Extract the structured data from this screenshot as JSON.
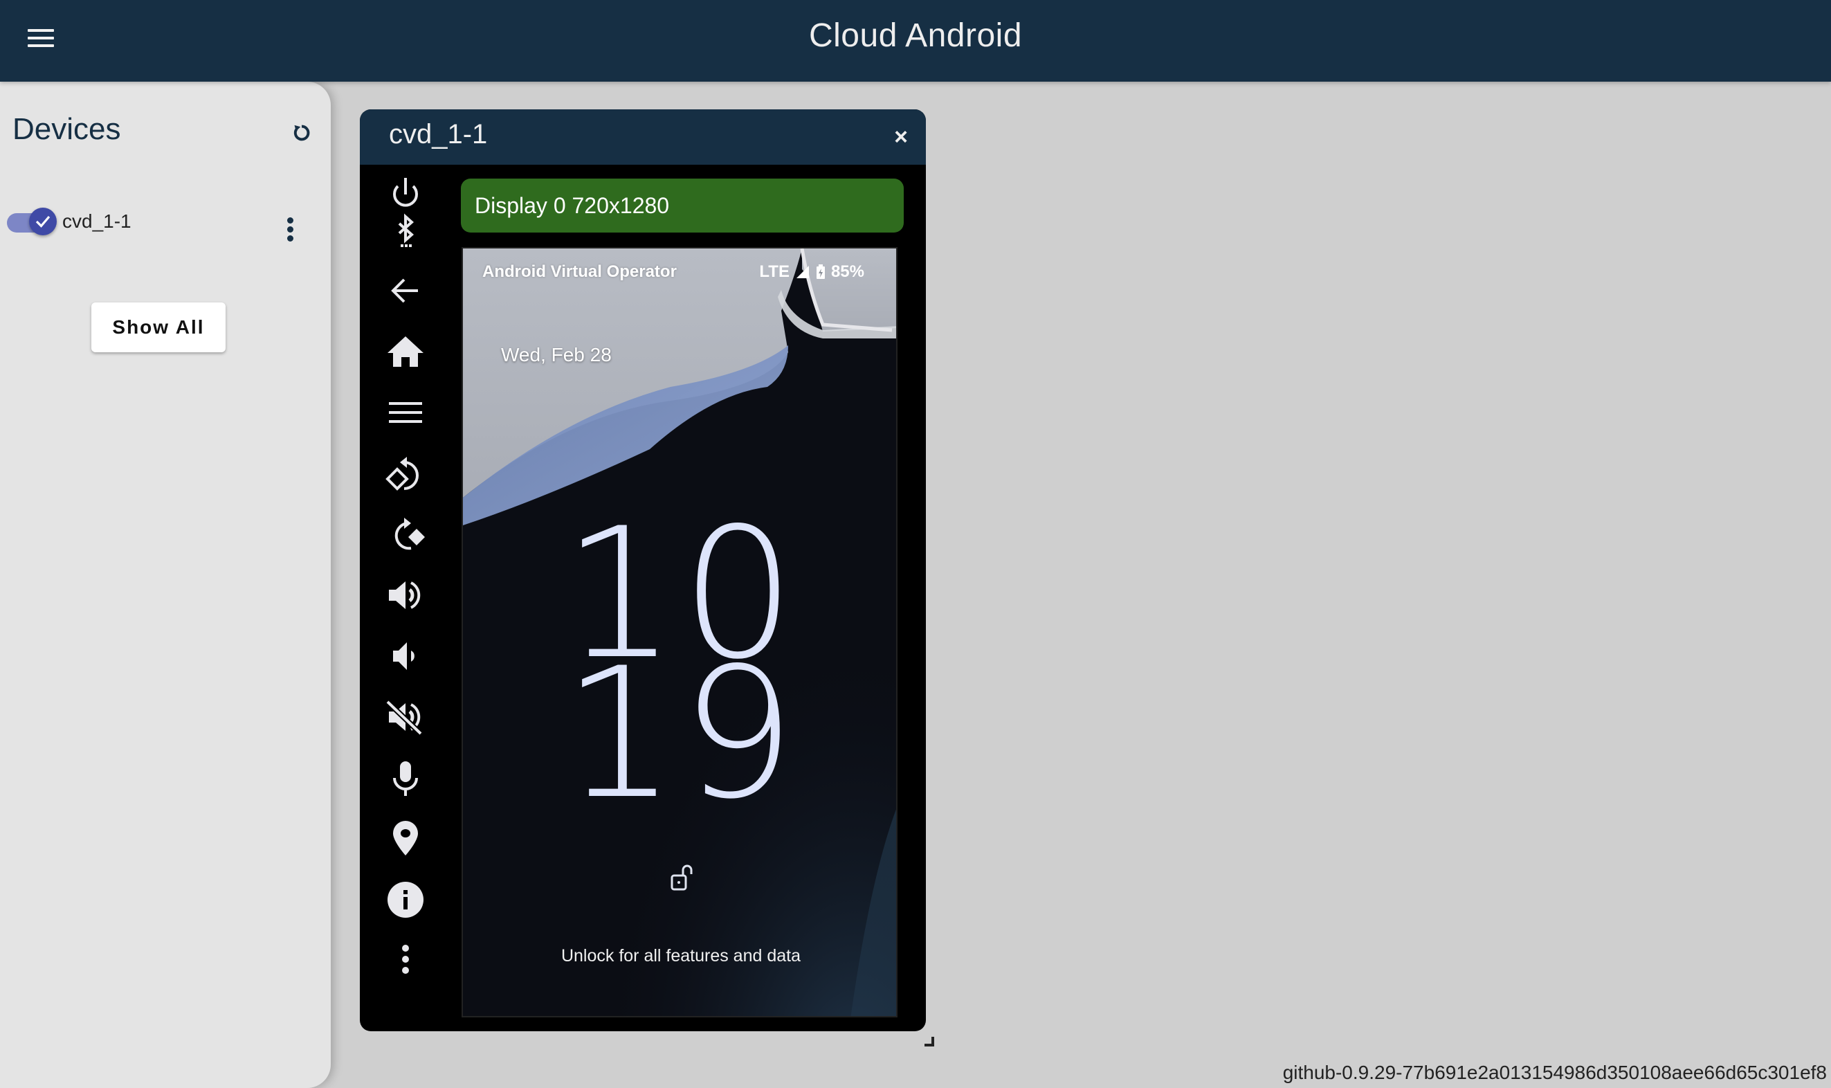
{
  "app": {
    "title": "Cloud Android",
    "menu_icon": "hamburger-menu-icon"
  },
  "sidebar": {
    "title": "Devices",
    "refresh_icon": "refresh-icon",
    "devices": [
      {
        "name": "cvd_1-1",
        "enabled": true,
        "more_icon": "more-vert-icon"
      }
    ],
    "show_all_label": "Show All"
  },
  "device_window": {
    "title": "cvd_1-1",
    "close_label": "×",
    "display_label": "Display 0 720x1280",
    "toolbar": [
      {
        "id": "power",
        "icon": "power-icon"
      },
      {
        "id": "bluetooth",
        "icon": "bluetooth-searching-icon"
      },
      {
        "id": "back",
        "icon": "arrow-back-icon"
      },
      {
        "id": "home",
        "icon": "home-icon"
      },
      {
        "id": "menu",
        "icon": "menu-icon"
      },
      {
        "id": "rotate-left",
        "icon": "rotate-left-icon"
      },
      {
        "id": "rotate-right",
        "icon": "rotate-right-icon"
      },
      {
        "id": "volume-up",
        "icon": "volume-up-icon"
      },
      {
        "id": "volume-down",
        "icon": "volume-down-icon"
      },
      {
        "id": "volume-mute",
        "icon": "volume-off-icon"
      },
      {
        "id": "microphone",
        "icon": "mic-icon"
      },
      {
        "id": "location",
        "icon": "location-icon"
      },
      {
        "id": "info",
        "icon": "info-icon"
      },
      {
        "id": "more",
        "icon": "more-vert-icon"
      }
    ],
    "screen": {
      "carrier": "Android Virtual Operator",
      "network": "LTE",
      "battery": "85%",
      "date": "Wed, Feb 28",
      "clock_hour": "10",
      "clock_minute": "19",
      "unlock_hint": "Unlock for all features and data"
    }
  },
  "footer": {
    "version": "github-0.9.29-77b691e2a013154986d350108aee66d65c301ef8"
  }
}
